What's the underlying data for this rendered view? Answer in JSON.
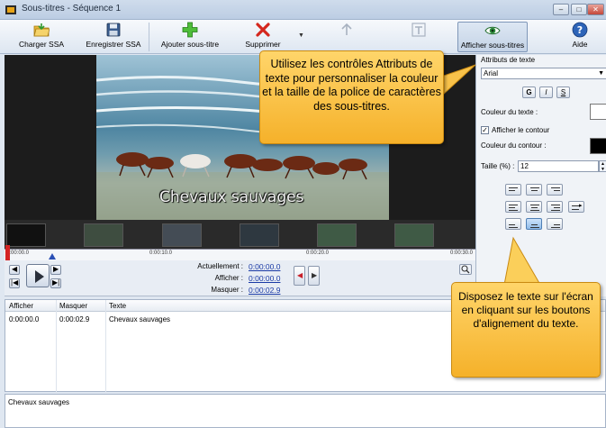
{
  "window": {
    "title": "Sous-titres - Séquence 1"
  },
  "toolbar": {
    "load_ssa": "Charger SSA",
    "save_ssa": "Enregistrer SSA",
    "add_subtitle": "Ajouter sous-titre",
    "delete": "Supprimer",
    "show_subtitles": "Afficher sous-titres",
    "help": "Aide"
  },
  "video": {
    "subtitle_text": "Chevaux sauvages"
  },
  "timeline": {
    "ticks": [
      "0:00:00.0",
      "0:00:10.0",
      "0:00:20.0",
      "0:00:30.0"
    ],
    "position_fraction": 0.0
  },
  "transport": {
    "current_label": "Actuellement :",
    "current_value": "0:00:00.0",
    "show_label": "Afficher :",
    "show_value": "0:00:00.0",
    "hide_label": "Masquer :",
    "hide_value": "0:00:02.9"
  },
  "list": {
    "columns": [
      "Afficher",
      "Masquer",
      "Texte"
    ],
    "rows": [
      {
        "show": "0:00:00.0",
        "hide": "0:00:02.9",
        "text": "Chevaux sauvages"
      }
    ]
  },
  "editor": {
    "text": "Chevaux sauvages"
  },
  "panel": {
    "header": "Attributs de texte",
    "font": "Arial",
    "bold": "G",
    "italic": "I",
    "underline": "S",
    "text_color_label": "Couleur du texte :",
    "text_color": "#ffffff",
    "show_outline_label": "Afficher le contour",
    "show_outline_checked": true,
    "outline_color_label": "Couleur du contour :",
    "outline_color": "#000000",
    "size_label": "Taille (%) :",
    "size_value": "12",
    "alignment_selected": "bottom-center"
  },
  "callouts": {
    "text_attributes": "Utilisez les contrôles Attributs de texte pour personnaliser la couleur et la taille de la police de caractères des sous-titres.",
    "alignment": "Disposez le texte sur l'écran en cliquant sur les boutons d'alignement du texte."
  }
}
